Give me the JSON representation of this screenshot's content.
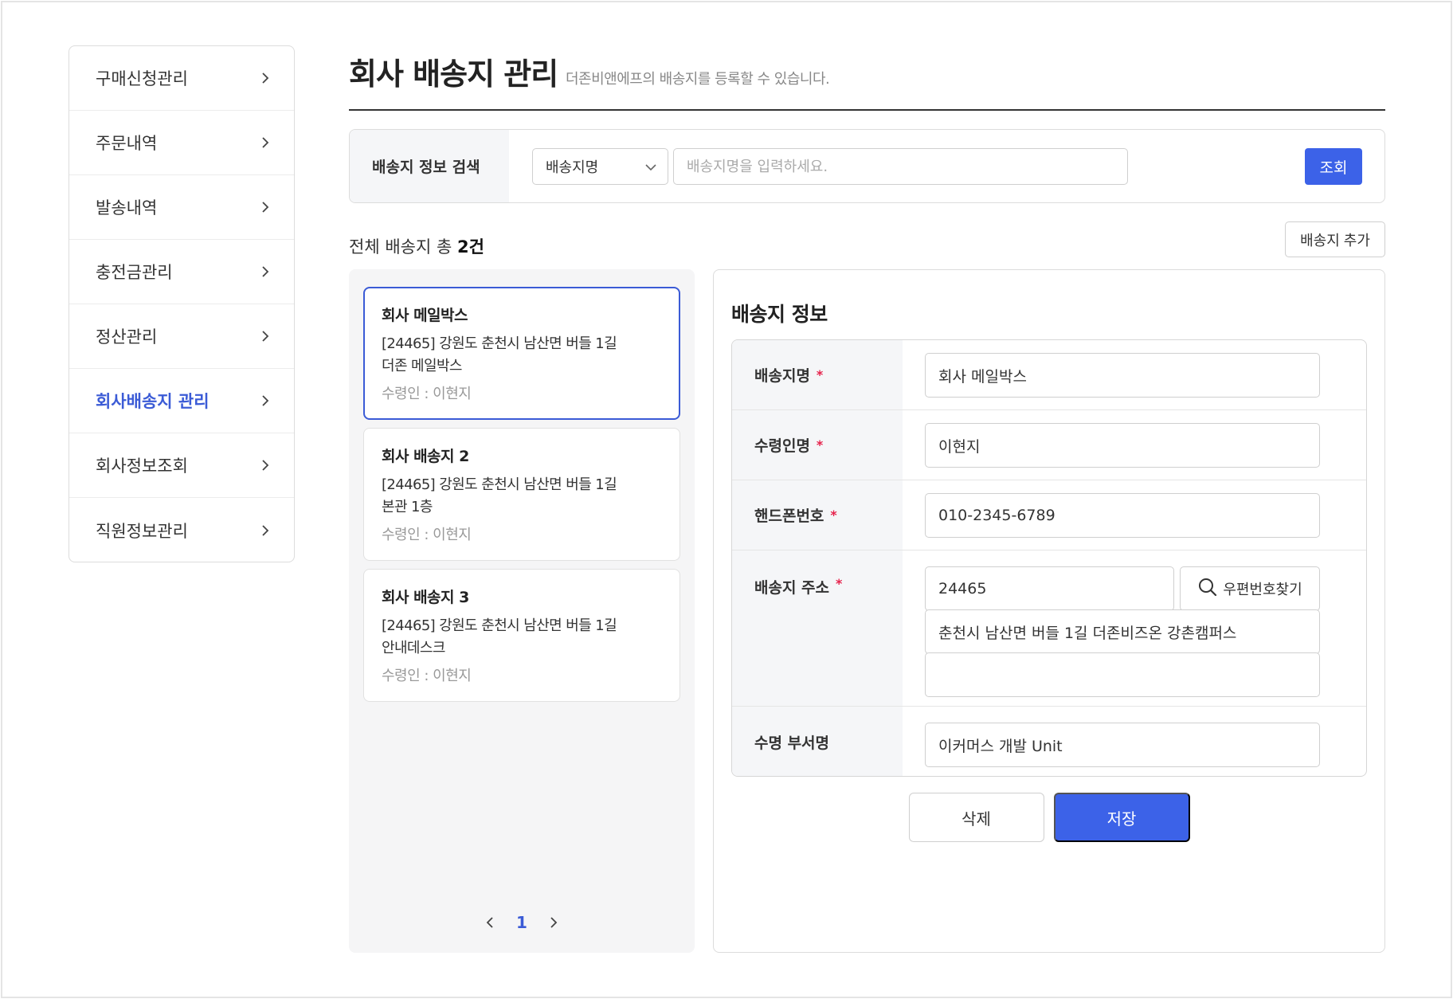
{
  "sidebar": {
    "items": [
      {
        "label": "구매신청관리"
      },
      {
        "label": "주문내역"
      },
      {
        "label": "발송내역"
      },
      {
        "label": "충전금관리"
      },
      {
        "label": "정산관리"
      },
      {
        "label": "회사배송지 관리",
        "active": true
      },
      {
        "label": "회사정보조회"
      },
      {
        "label": "직원정보관리"
      }
    ]
  },
  "header": {
    "title": "회사 배송지 관리",
    "subtitle": "더존비앤에프의 배송지를 등록할 수 있습니다."
  },
  "search": {
    "label": "배송지 정보 검색",
    "select_value": "배송지명",
    "placeholder": "배송지명을 입력하세요.",
    "button": "조회"
  },
  "list": {
    "count_prefix": "전체 배송지 총 ",
    "count_value": "2건",
    "add_button": "배송지 추가",
    "cards": [
      {
        "name": "회사 메일박스",
        "addr1": "[24465] 강원도 춘천시 남산면 버들 1길",
        "addr2": "더존 메일박스",
        "receiver": "수령인 : 이현지"
      },
      {
        "name": "회사 배송지 2",
        "addr1": "[24465] 강원도 춘천시 남산면 버들 1길",
        "addr2": "본관 1층",
        "receiver": "수령인 : 이현지"
      },
      {
        "name": "회사 배송지 3",
        "addr1": "[24465] 강원도 춘천시 남산면 버들 1길",
        "addr2": "안내데스크",
        "receiver": "수령인 : 이현지"
      }
    ],
    "page": "1"
  },
  "detail": {
    "title": "배송지 정보",
    "req_mark": "*",
    "fields": {
      "name_label": "배송지명",
      "name_value": "회사 메일박스",
      "receiver_label": "수령인명",
      "receiver_value": "이현지",
      "phone_label": "핸드폰번호",
      "phone_value": "010-2345-6789",
      "address_label": "배송지 주소",
      "zip_value": "24465",
      "zip_button": "우편번호찾기",
      "addr1_value": "춘천시 남산면 버들 1길 더존비즈온 강촌캠퍼스",
      "addr2_value": "",
      "dept_label": "수명 부서명",
      "dept_value": "이커머스 개발 Unit"
    },
    "delete_button": "삭제",
    "save_button": "저장"
  },
  "colors": {
    "accent": "#3c62e8",
    "active_text": "#3b5bd6",
    "required": "#e6224b"
  },
  "icons": [
    "chevron-right-icon",
    "chevron-down-icon",
    "chevron-left-icon",
    "search-icon"
  ]
}
